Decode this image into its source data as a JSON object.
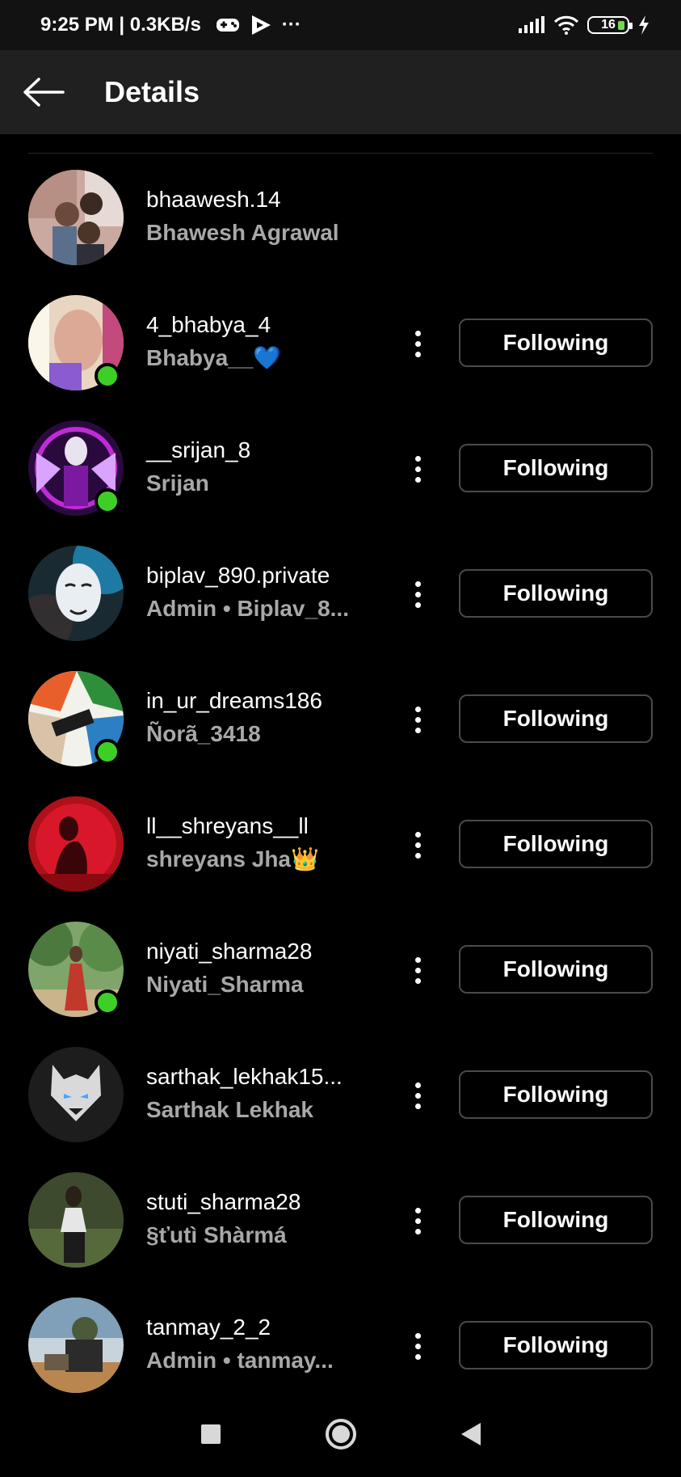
{
  "status_bar": {
    "time_speed": "9:25 PM | 0.3KB/s",
    "more": "···",
    "battery": "16"
  },
  "header": {
    "title": "Details"
  },
  "users": [
    {
      "username": "bhaawesh.14",
      "fullname": "Bhawesh Agrawal",
      "online": false,
      "has_follow": false
    },
    {
      "username": "4_bhabya_4",
      "fullname": "Bhabya__💙",
      "online": true,
      "has_follow": true
    },
    {
      "username": "__srijan_8",
      "fullname": "Srijan",
      "online": true,
      "has_follow": true
    },
    {
      "username": "biplav_890.private",
      "fullname": "Admin • Biplav_8...",
      "online": false,
      "has_follow": true
    },
    {
      "username": "in_ur_dreams186",
      "fullname": "Ñorã_3418",
      "online": true,
      "has_follow": true
    },
    {
      "username": "ll__shreyans__ll",
      "fullname": "shreyans Jha👑",
      "online": false,
      "has_follow": true
    },
    {
      "username": "niyati_sharma28",
      "fullname": "Niyati_Sharma",
      "online": true,
      "has_follow": true
    },
    {
      "username": "sarthak_lekhak15...",
      "fullname": "Sarthak Lekhak",
      "online": false,
      "has_follow": true
    },
    {
      "username": "stuti_sharma28",
      "fullname": "§ťutì Shàrmá",
      "online": false,
      "has_follow": true
    },
    {
      "username": "tanmay_2_2",
      "fullname": "Admin • tanmay...",
      "online": false,
      "has_follow": true
    }
  ],
  "follow_label": "Following",
  "colors": {
    "background": "#000000",
    "header_bg": "#202020",
    "online_dot": "#3ecf27",
    "secondary_text": "#a8a8a8"
  }
}
